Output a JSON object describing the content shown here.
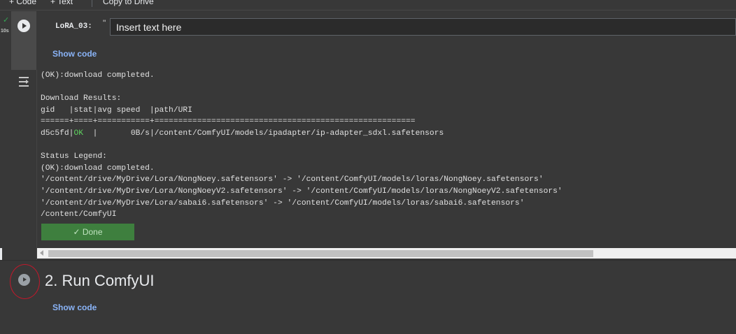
{
  "toolbar": {
    "code_label": "+ Code",
    "text_label": "+ Text",
    "copy_label": "Copy to Drive"
  },
  "cell": {
    "exec_time": "10s",
    "param_label": "LoRA_03:",
    "quote": "\"",
    "input_value": "",
    "input_placeholder": "Insert text here",
    "show_code": "Show code"
  },
  "output": {
    "lines": [
      "(OK):download completed.",
      "",
      "Download Results:",
      "gid   |stat|avg speed  |path/URI",
      "======+====+===========+=======================================================",
      "d5c5fd|OK  |       0B/s|/content/ComfyUI/models/ipadapter/ip-adapter_sdxl.safetensors",
      "",
      "Status Legend:",
      "(OK):download completed.",
      "'/content/drive/MyDrive/Lora/NongNoey.safetensors' -> '/content/ComfyUI/models/loras/NongNoey.safetensors'",
      "'/content/drive/MyDrive/Lora/NongNoeyV2.safetensors' -> '/content/ComfyUI/models/loras/NongNoeyV2.safetensors'",
      "'/content/drive/MyDrive/Lora/sabai6.safetensors' -> '/content/ComfyUI/models/loras/sabai6.safetensors'",
      "/content/ComfyUI"
    ],
    "done_label": "✓ Done"
  },
  "section": {
    "title": "2. Run ComfyUI",
    "show_code": "Show code"
  },
  "icons": {
    "run": "play-icon",
    "check": "check-icon",
    "output_menu": "output-options-icon"
  },
  "colors": {
    "background": "#383838",
    "link": "#8ab4f8",
    "ok": "#5fd35f",
    "done_button": "#3e7f3e",
    "annotation": "#c0182b"
  }
}
